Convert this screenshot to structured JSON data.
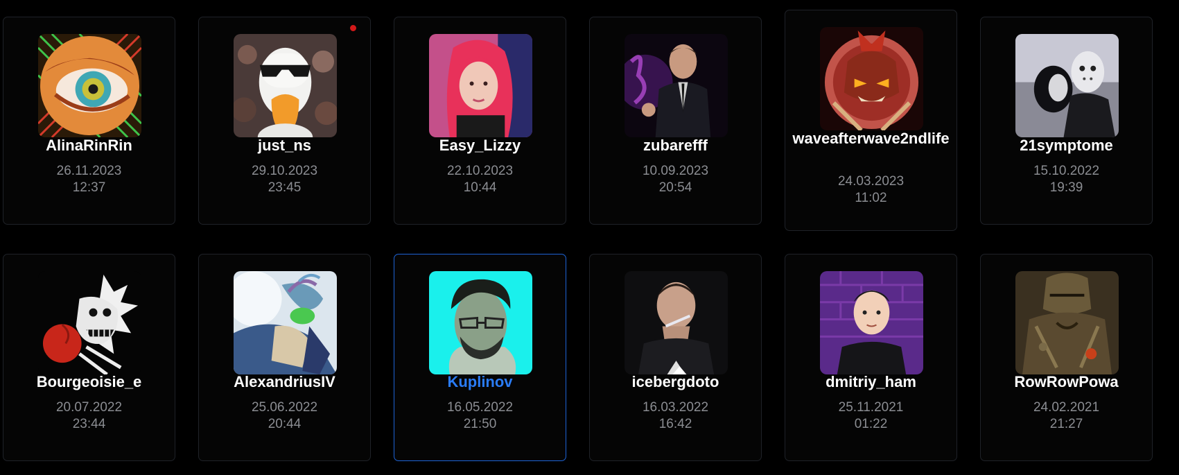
{
  "accent_color": "#1d63d6",
  "selected_name_color": "#2a7cf6",
  "users": [
    {
      "name": "AlinaRinRin",
      "date": "26.11.2023",
      "time": "12:37"
    },
    {
      "name": "just_ns",
      "date": "29.10.2023",
      "time": "23:45",
      "unread": true
    },
    {
      "name": "Easy_Lizzy",
      "date": "22.10.2023",
      "time": "10:44"
    },
    {
      "name": "zubarefff",
      "date": "10.09.2023",
      "time": "20:54"
    },
    {
      "name": "waveafterwave2ndlife",
      "date": "24.03.2023",
      "time": "11:02"
    },
    {
      "name": "21symptome",
      "date": "15.10.2022",
      "time": "19:39"
    },
    {
      "name": "Bourgeoisie_e",
      "date": "20.07.2022",
      "time": "23:44"
    },
    {
      "name": "AlexandriusIV",
      "date": "25.06.2022",
      "time": "20:44"
    },
    {
      "name": "Kuplinov",
      "date": "16.05.2022",
      "time": "21:50",
      "selected": true
    },
    {
      "name": "icebergdoto",
      "date": "16.03.2022",
      "time": "16:42"
    },
    {
      "name": "dmitriy_ham",
      "date": "25.11.2021",
      "time": "01:22"
    },
    {
      "name": "RowRowPowa",
      "date": "24.02.2021",
      "time": "21:27"
    }
  ]
}
